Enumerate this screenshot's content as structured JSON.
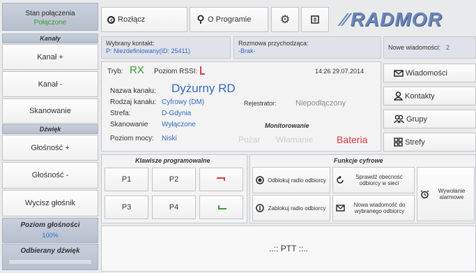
{
  "connection": {
    "label": "Stan połączenia",
    "value": "Połączone"
  },
  "sidebar": {
    "channels_header": "Kanały",
    "channel_up": "Kanał +",
    "channel_down": "Kanał -",
    "scanning": "Skanowanie",
    "sound_header": "Dźwięk",
    "volume_up": "Głośność +",
    "volume_down": "Głośność -",
    "mute": "Wycisz głośnik",
    "volume_level_label": "Poziom głośności",
    "volume_level_value": "100%",
    "received_sound_label": "Odbierany dźwięk"
  },
  "toolbar": {
    "disconnect_label": "Rozłącz",
    "about_label": "O Programie",
    "logo_text": "RADMOR"
  },
  "info": {
    "selected_contact_label": "Wybrany kontakt:",
    "selected_contact_value": "P: Niezdefiniowany(ID: 25411)",
    "incoming_call_label": "Rozmowa przychodząca:",
    "incoming_call_value": "-Brak-",
    "new_messages_label": "Nowe wiadomości:",
    "new_messages_count": "2"
  },
  "main": {
    "mode_label": "Tryb:",
    "mode_value": "RX",
    "rssi_label": "Poziom RSSI:",
    "datetime": "14:26 29.07.2014",
    "channel_name_label": "Nazwa kanału:",
    "channel_name_value": "Dyżurny RD",
    "channel_type_label": "Rodzaj kanału:",
    "channel_type_value": "Cyfrowy (DM)",
    "zone_label": "Strefa:",
    "zone_value": "D-Gdynia",
    "scanning_label": "Skanowanie",
    "scanning_value": "Wyłączone",
    "power_label": "Poziom mocy:",
    "power_value": "Niski",
    "recorder_label": "Rejestrator:",
    "recorder_value": "Niepodłączony",
    "monitoring_label": "Monitorowanie",
    "alarm_fire": "Pożar",
    "alarm_burglary": "Włamanie",
    "alarm_battery": "Bateria"
  },
  "right_menu": {
    "messages": "Wiadomości",
    "contacts": "Kontakty",
    "groups": "Grupy",
    "zones": "Strefy"
  },
  "programmable": {
    "header": "Klawisze programowalne",
    "p1": "P1",
    "p2": "P2",
    "p3": "P3",
    "p4": "P4"
  },
  "digital": {
    "header": "Funkcje cyfrowe",
    "unblock": "Odblokuj radio odbiorcy",
    "check_presence": "Sprawdź obecność odbiorcy w sieci",
    "alarm_call": "Wywołanie alarmowe",
    "block": "Zablokuj radio odbiorcy",
    "new_message": "Nowa wiadomość do wybranego odbiorcy"
  },
  "ptt": {
    "label": "..:: PTT ::.."
  },
  "colors": {
    "accent_blue": "#3567c8",
    "green": "#3a9a30",
    "alarm_red": "#e0393a",
    "inactive": "#bdbdbd"
  }
}
